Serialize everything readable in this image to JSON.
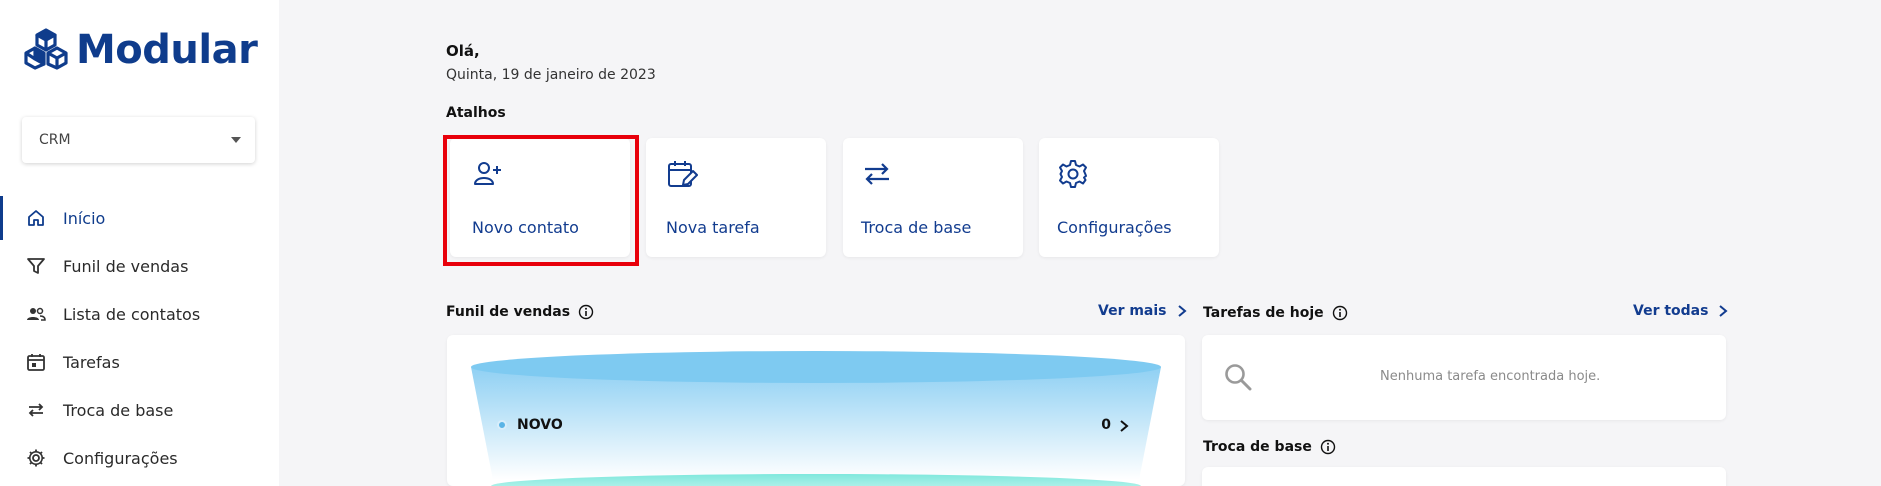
{
  "app": {
    "name": "Modular",
    "brand_color": "#0f3c8c",
    "highlight_color": "#e8000b"
  },
  "sidebar": {
    "module_select": {
      "value": "CRM"
    },
    "items": [
      {
        "label": "Início",
        "icon": "home-icon",
        "active": true
      },
      {
        "label": "Funil de vendas",
        "icon": "filter-icon",
        "active": false
      },
      {
        "label": "Lista de contatos",
        "icon": "contacts-icon",
        "active": false
      },
      {
        "label": "Tarefas",
        "icon": "calendar-icon",
        "active": false
      },
      {
        "label": "Troca de base",
        "icon": "swap-icon",
        "active": false
      },
      {
        "label": "Configurações",
        "icon": "gear-icon",
        "active": false
      }
    ]
  },
  "main": {
    "greeting": "Olá,",
    "date": "Quinta, 19 de janeiro de 2023",
    "shortcuts": {
      "title": "Atalhos",
      "items": [
        {
          "label": "Novo contato",
          "icon": "user-plus-icon",
          "highlighted": true
        },
        {
          "label": "Nova tarefa",
          "icon": "calendar-edit-icon"
        },
        {
          "label": "Troca de base",
          "icon": "swap-icon"
        },
        {
          "label": "Configurações",
          "icon": "gear-icon"
        }
      ]
    },
    "funnel": {
      "title": "Funil de vendas",
      "link": "Ver mais",
      "stages": [
        {
          "label": "NOVO",
          "count": "0"
        }
      ]
    },
    "tasks": {
      "title": "Tarefas de hoje",
      "link": "Ver todas",
      "empty_text": "Nenhuma tarefa encontrada hoje."
    },
    "base_swap": {
      "title": "Troca de base"
    }
  }
}
